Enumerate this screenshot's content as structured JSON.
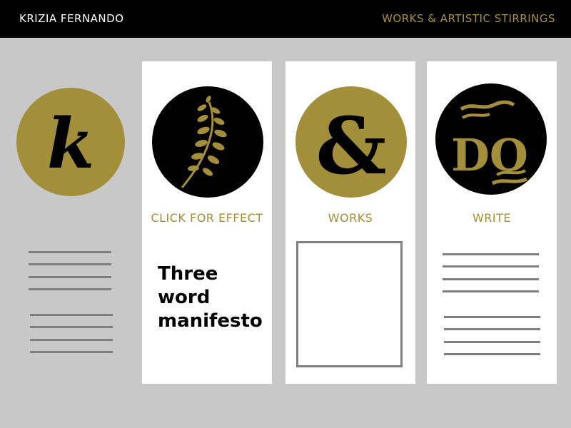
{
  "header": {
    "brand": "KRIZIA FERNANDO",
    "tagline": "WORKS & ARTISTIC STIRRINGS"
  },
  "logo": {
    "letter": "k"
  },
  "cards": [
    {
      "label": "CLICK FOR EFFECT",
      "icon": "leaf-sprig-icon",
      "body": "Three word manifesto"
    },
    {
      "label": "WORKS",
      "icon": "ampersand-icon"
    },
    {
      "label": "WRITE",
      "icon": "do-lettering-icon",
      "lettering": "DO"
    }
  ],
  "colors": {
    "accent": "#a38e3a",
    "bar": "#000000",
    "background": "#c8c8c8",
    "card": "#ffffff",
    "placeholder_line": "#7f7f7f"
  }
}
